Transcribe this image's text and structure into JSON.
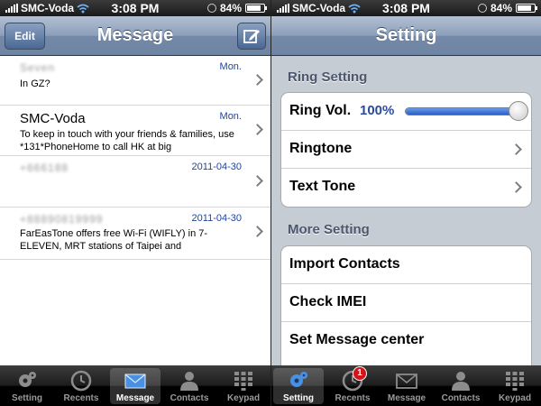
{
  "left": {
    "status": {
      "carrier": "SMC-Voda",
      "time": "3:08 PM",
      "battery": "84%"
    },
    "nav": {
      "edit_label": "Edit",
      "title": "Message"
    },
    "messages": [
      {
        "name": "Seven",
        "date": "Mon.",
        "preview": "In GZ?"
      },
      {
        "name": "SMC-Voda",
        "date": "Mon.",
        "preview": "To keep in touch with your friends & families, use *131*PhoneHome to call HK at big"
      },
      {
        "name": "+666188",
        "date": "2011-04-30",
        "preview": ""
      },
      {
        "name": "+88890819999",
        "date": "2011-04-30",
        "preview": "FarEasTone offers free Wi-Fi (WIFLY) in 7-ELEVEN, MRT stations of Taipei and"
      }
    ],
    "tabs": [
      {
        "label": "Setting",
        "icon": "gear-icon",
        "active": false
      },
      {
        "label": "Recents",
        "icon": "clock-icon",
        "active": false
      },
      {
        "label": "Message",
        "icon": "envelope-icon",
        "active": true
      },
      {
        "label": "Contacts",
        "icon": "person-icon",
        "active": false
      },
      {
        "label": "Keypad",
        "icon": "keypad-icon",
        "active": false
      }
    ]
  },
  "right": {
    "status": {
      "carrier": "SMC-Voda",
      "time": "3:08 PM",
      "battery": "84%"
    },
    "nav": {
      "title": "Setting"
    },
    "ring_section": {
      "title": "Ring Setting",
      "ring_vol_label": "Ring Vol.",
      "ring_vol_value": "100%",
      "ring_vol_level": 1.0,
      "ringtone_label": "Ringtone",
      "text_tone_label": "Text Tone"
    },
    "more_section": {
      "title": "More Setting",
      "items": [
        "Import Contacts",
        "Check IMEI",
        "Set Message center"
      ]
    },
    "tabs": [
      {
        "label": "Setting",
        "icon": "gear-icon",
        "active": true
      },
      {
        "label": "Recents",
        "icon": "clock-icon",
        "active": false,
        "badge": "1"
      },
      {
        "label": "Message",
        "icon": "envelope-icon",
        "active": false
      },
      {
        "label": "Contacts",
        "icon": "person-icon",
        "active": false
      },
      {
        "label": "Keypad",
        "icon": "keypad-icon",
        "active": false
      }
    ]
  },
  "colors": {
    "nav_blue": "#7489a8",
    "link_blue": "#1f44a4",
    "settings_bg": "#c5ccd4",
    "badge_red": "#d0161a"
  }
}
